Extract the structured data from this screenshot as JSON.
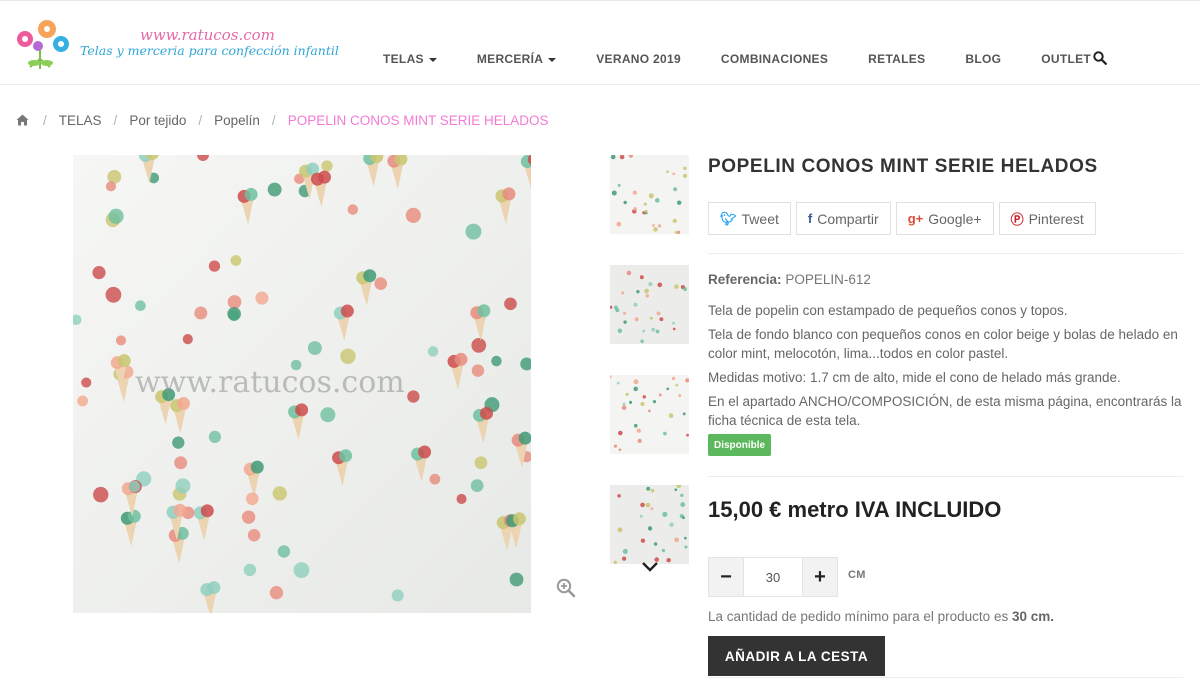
{
  "brand": {
    "url_text": "www.ratucos.com",
    "tagline": "Telas y merceria para confección infantil"
  },
  "nav": {
    "items": [
      {
        "label": "TELAS",
        "dropdown": true
      },
      {
        "label": "MERCERÍA",
        "dropdown": true
      },
      {
        "label": "VERANO 2019",
        "dropdown": false
      },
      {
        "label": "COMBINACIONES",
        "dropdown": false
      },
      {
        "label": "RETALES",
        "dropdown": false
      },
      {
        "label": "BLOG",
        "dropdown": false
      },
      {
        "label": "OUTLET",
        "dropdown": false
      }
    ],
    "search_icon": "search-icon"
  },
  "breadcrumb": {
    "home_icon": "home-icon",
    "separator": "/",
    "links": [
      "TELAS",
      "Por tejido",
      "Popelín"
    ],
    "current": "POPELIN CONOS MINT SERIE HELADOS"
  },
  "gallery": {
    "watermark": "www.ratucos.com",
    "zoom_icon": "zoom-in-icon",
    "thumbnails_count": 4,
    "next_icon": "chevron-down-icon"
  },
  "product": {
    "title": "POPELIN CONOS MINT SERIE HELADOS",
    "share": {
      "tweet": "Tweet",
      "facebook": "Compartir",
      "google": "Google+",
      "pinterest": "Pinterest"
    },
    "reference_label": "Referencia:",
    "reference_value": "POPELIN-612",
    "description": [
      "Tela de popelin con estampado de pequeños conos y topos.",
      "Tela de fondo blanco con pequeños conos en color beige y bolas de helado en color mint, melocotón, lima...todos en color pastel.",
      "Medidas motivo: 1.7 cm de alto, mide el cono de helado más grande.",
      "En el apartado ANCHO/COMPOSICIÓN, de esta misma página, encontrarás la ficha técnica de esta tela."
    ],
    "availability": "Disponible",
    "price": "15,00 € metro IVA INCLUIDO",
    "quantity": {
      "minus": "−",
      "value": "30",
      "plus": "+",
      "unit": "CM"
    },
    "min_qty_text": "La cantidad de pedido mínimo para el producto es",
    "min_qty_value": "30 cm.",
    "add_to_cart": "AÑADIR A LA CESTA"
  },
  "colors": {
    "accent_pink": "#f37bd5",
    "brand_blue": "#2fa6d6",
    "available_green": "#5cb85c",
    "cart_button": "#333333"
  }
}
